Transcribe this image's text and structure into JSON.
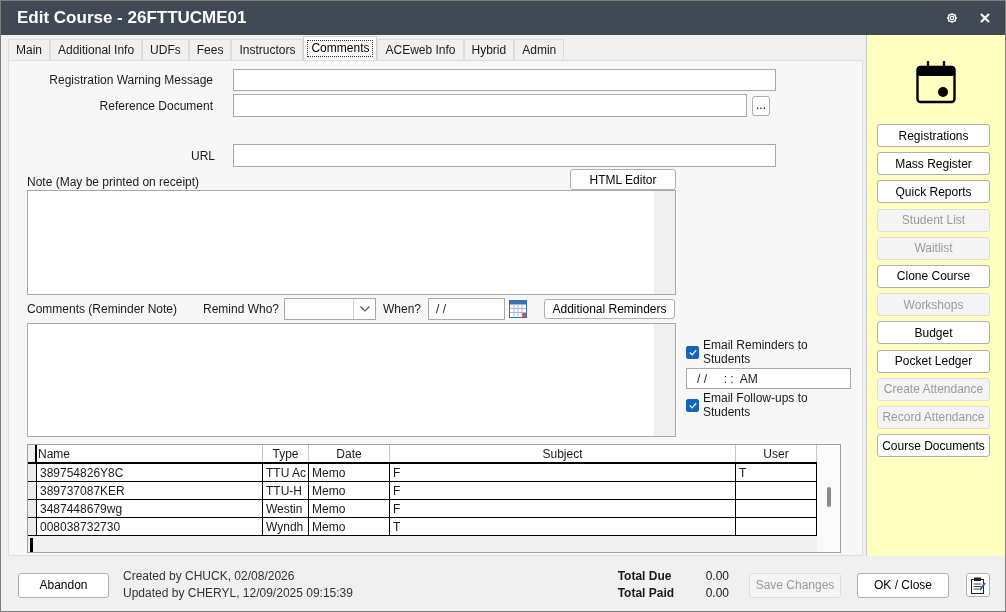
{
  "window": {
    "title": "Edit Course - 26FTTUCME01"
  },
  "tabs": [
    {
      "label": "Main",
      "selected": false
    },
    {
      "label": "Additional Info",
      "selected": false
    },
    {
      "label": "UDFs",
      "selected": false
    },
    {
      "label": "Fees",
      "selected": false
    },
    {
      "label": "Instructors",
      "selected": false
    },
    {
      "label": "Comments",
      "selected": true
    },
    {
      "label": "ACEweb Info",
      "selected": false
    },
    {
      "label": "Hybrid",
      "selected": false
    },
    {
      "label": "Admin",
      "selected": false
    }
  ],
  "registration_warning_message": {
    "label": "Registration Warning Message"
  },
  "reference_document": {
    "label": "Reference Document",
    "browse_button": "..."
  },
  "url": {
    "label": "URL"
  },
  "note": {
    "label": "Note (May be printed on receipt)",
    "editor_button": "HTML Editor"
  },
  "reminder": {
    "label": "Comments (Reminder Note)",
    "remind_who_label": "Remind Who?",
    "when_label": "When?",
    "when_value": "/ /",
    "additional_button": "Additional Reminders"
  },
  "email_reminders": {
    "label": "Email Reminders to Students",
    "checked": true
  },
  "reminder_time": {
    "value": "/ /     : :  AM"
  },
  "email_followups": {
    "label": "Email Follow-ups to Students",
    "checked": true
  },
  "table": {
    "columns": [
      "Name",
      "Type",
      "Date",
      "Subject",
      "User"
    ],
    "rows": [
      {
        "cells": [
          "389754826Y8C",
          "TTU Ac",
          "Memo",
          "F",
          "T"
        ]
      },
      {
        "cells": [
          "389737087KER",
          "TTU-H",
          "Memo",
          "F"
        ]
      },
      {
        "cells": [
          "3487448679wg",
          "Westin",
          "Memo",
          "F"
        ]
      },
      {
        "cells": [
          "008038732730",
          "Wyndh",
          "Memo",
          "T"
        ]
      }
    ]
  },
  "actions": [
    {
      "label": "Registrations",
      "disabled": false
    },
    {
      "label": "Mass Register",
      "disabled": false
    },
    {
      "label": "Quick Reports",
      "disabled": false
    },
    {
      "label": "Student List",
      "disabled": true
    },
    {
      "label": "Waitlist",
      "disabled": true
    },
    {
      "label": "Clone Course",
      "disabled": false
    },
    {
      "label": "Workshops",
      "disabled": true
    },
    {
      "label": "Budget",
      "disabled": false
    },
    {
      "label": "Pocket Ledger",
      "disabled": false
    },
    {
      "label": "Create Attendance",
      "disabled": true
    },
    {
      "label": "Record Attendance",
      "disabled": true
    },
    {
      "label": "Course Documents",
      "disabled": false
    }
  ],
  "footer": {
    "abandon_button": "Abandon",
    "created": "Created by CHUCK, 02/08/2026",
    "updated": "Updated by CHERYL, 12/09/2025 09:15:39",
    "totals": [
      {
        "label": "Total Due",
        "value": "0.00"
      },
      {
        "label": "Total Paid",
        "value": "0.00"
      }
    ],
    "buttons": [
      {
        "label": "Save Changes",
        "disabled": true
      },
      {
        "label": "OK / Close",
        "disabled": false
      }
    ]
  }
}
